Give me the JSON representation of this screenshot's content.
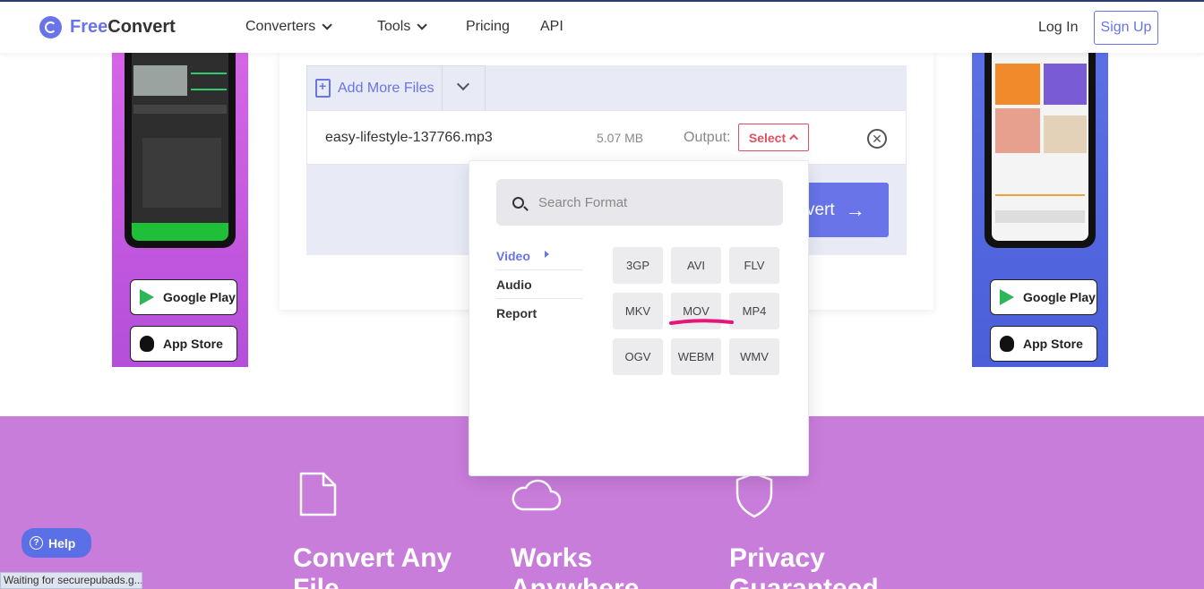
{
  "header": {
    "logo_free": "Free",
    "logo_convert": "Convert",
    "nav": [
      "Converters",
      "Tools",
      "Pricing",
      "API"
    ],
    "login": "Log In",
    "signup": "Sign Up"
  },
  "ads": {
    "google_play": "Google Play",
    "app_store": "App Store"
  },
  "converter": {
    "add_files_label": "Add More Files",
    "file_name": "easy-lifestyle-137766.mp3",
    "file_size": "5.07 MB",
    "output_label": "Output:",
    "select_label": "Select",
    "convert_label": "vert"
  },
  "format_dropdown": {
    "search_placeholder": "Search Format",
    "categories": [
      "Video",
      "Audio",
      "Report"
    ],
    "active_category": "Video",
    "formats": [
      "3GP",
      "AVI",
      "FLV",
      "MKV",
      "MOV",
      "MP4",
      "OGV",
      "WEBM",
      "WMV"
    ],
    "annotation_color": "#e6157a"
  },
  "features": {
    "titles": [
      "Convert Any File",
      "Works Anywhere",
      "Privacy Guaranteed"
    ]
  },
  "help_label": "Help",
  "status_text": "Waiting for securepubads.g...",
  "colors": {
    "brand": "#6874e8",
    "select_red": "#e04f5f",
    "feature_bg": "#c97ddb"
  }
}
